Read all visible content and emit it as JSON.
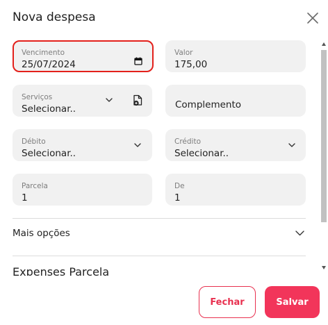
{
  "dialog": {
    "title": "Nova despesa"
  },
  "fields": {
    "vencimento": {
      "label": "Vencimento",
      "value": "25/07/2024"
    },
    "valor": {
      "label": "Valor",
      "value": "175,00"
    },
    "servicos": {
      "label": "Serviços",
      "value": "Selecionar.."
    },
    "complemento": {
      "placeholder": "Complemento"
    },
    "debito": {
      "label": "Débito",
      "value": "Selecionar.."
    },
    "credito": {
      "label": "Crédito",
      "value": "Selecionar.."
    },
    "parcela": {
      "label": "Parcela",
      "value": "1"
    },
    "de": {
      "label": "De",
      "value": "1"
    }
  },
  "sections": {
    "mais_opcoes": "Mais opções",
    "expenses_parcela": "Expenses Parcela"
  },
  "buttons": {
    "fechar": "Fechar",
    "salvar": "Salvar"
  },
  "icons": {
    "close": "close-icon",
    "calendar": "calendar-icon",
    "chevron": "chevron-down-icon",
    "add_file": "add-file-icon"
  },
  "colors": {
    "accent": "#f2355a",
    "focus_border": "#e3201b",
    "field_bg": "#f1f1f1"
  }
}
